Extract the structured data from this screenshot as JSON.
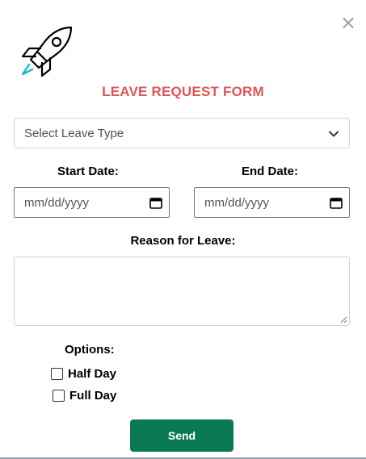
{
  "close_symbol": "×",
  "logo": {
    "icon": "rocket-icon"
  },
  "form": {
    "title": "LEAVE REQUEST FORM",
    "leave_type": {
      "selected": "Select Leave Type"
    },
    "start_date": {
      "label": "Start Date:",
      "value": "mm/dd/yyyy"
    },
    "end_date": {
      "label": "End Date:",
      "value": "mm/dd/yyyy"
    },
    "reason": {
      "label": "Reason for Leave:",
      "value": ""
    },
    "options": {
      "label": "Options:",
      "items": [
        {
          "label": "Half Day",
          "checked": false
        },
        {
          "label": "Full Day",
          "checked": false
        }
      ]
    },
    "submit_label": "Send"
  },
  "colors": {
    "title": "#e05555",
    "button": "#0b7a52",
    "accent": "#1fb5c4"
  }
}
